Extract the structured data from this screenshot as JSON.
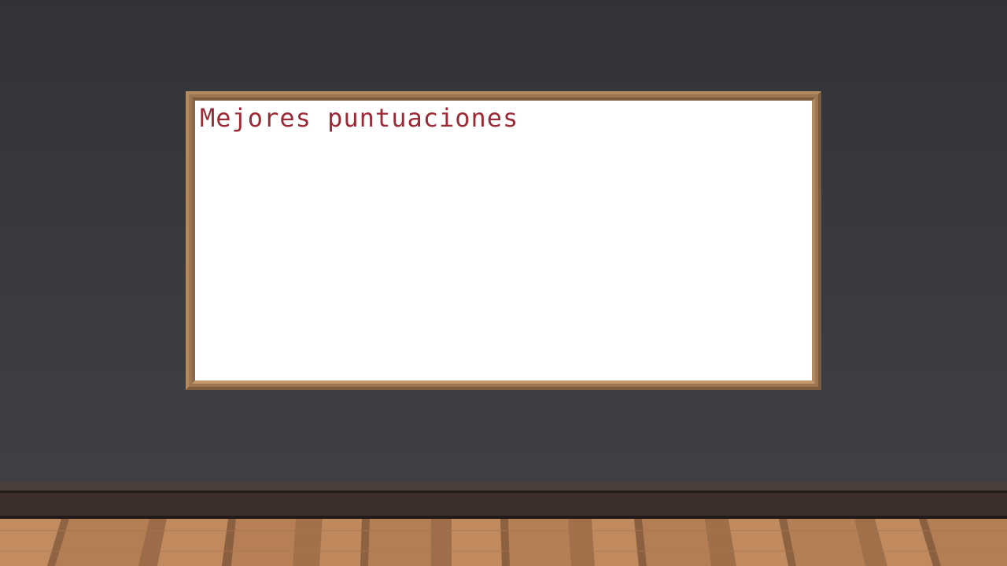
{
  "scoreboard": {
    "title": "Mejores puntuaciones",
    "entries": []
  },
  "colors": {
    "wall": "#35363c",
    "frame": "#9e7752",
    "board": "#ffffff",
    "title_text": "#9c2a36",
    "baseboard": "#3b2e2b",
    "floor": "#b47e55"
  }
}
